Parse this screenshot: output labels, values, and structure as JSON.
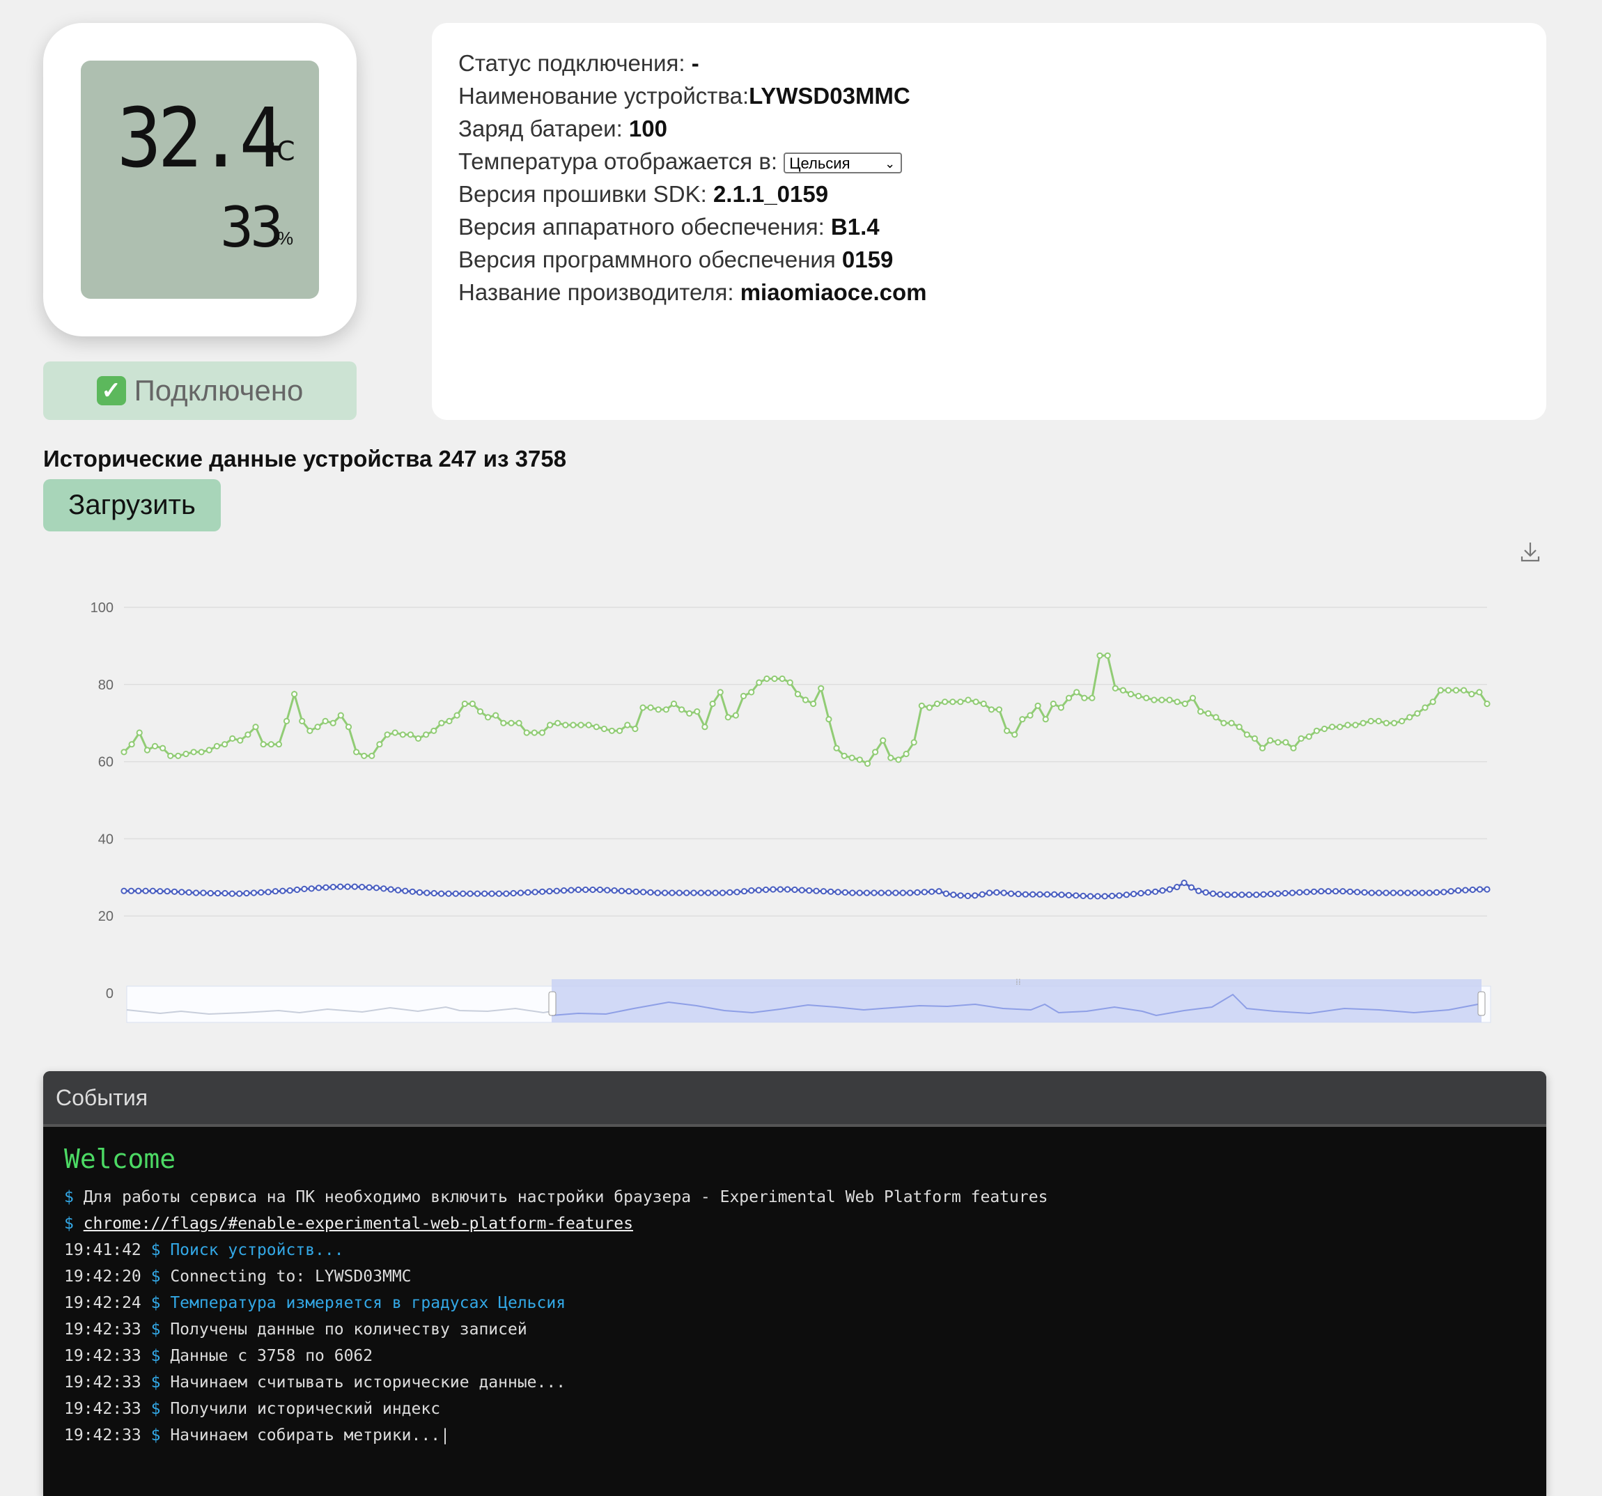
{
  "device": {
    "temperature": "32.4",
    "temperature_unit": "°C",
    "humidity": "33",
    "humidity_unit": "%"
  },
  "connection": {
    "badge_icon": "check-icon",
    "badge_label": "Подключено"
  },
  "info": {
    "status_label": "Статус подключения: ",
    "status_value": "-",
    "name_label": "Наименование устройства:",
    "name_value": "LYWSD03MMC",
    "battery_label": "Заряд батареи: ",
    "battery_value": "100",
    "temp_unit_label": "Температура отображается в: ",
    "temp_unit_selected": "Цельсия",
    "sdk_label": "Версия прошивки SDK: ",
    "sdk_value": "2.1.1_0159",
    "hw_label": "Версия аппаратного обеспечения: ",
    "hw_value": "B1.4",
    "sw_label": "Версия программного обеспечения ",
    "sw_value": "0159",
    "vendor_label": "Название производителя: ",
    "vendor_value": "miaomiaoce.com"
  },
  "history": {
    "title": "Исторические данные устройства 247 из 3758",
    "load_button": "Загрузить"
  },
  "chart_data": {
    "type": "line",
    "ylim": [
      0,
      100
    ],
    "yticks": [
      "0",
      "20",
      "40",
      "60",
      "80",
      "100"
    ],
    "grid": true,
    "series": [
      {
        "color": "#91cc75",
        "values": [
          62.5,
          64.5,
          67.5,
          63,
          64,
          63.5,
          61.5,
          61.5,
          62,
          62.5,
          62.5,
          63,
          64,
          64.5,
          66,
          65.5,
          67,
          69,
          64.5,
          64.5,
          64.5,
          70.5,
          77.5,
          70.5,
          68,
          69,
          70.5,
          70,
          72,
          69,
          62.5,
          61.5,
          61.5,
          64.5,
          67,
          67.5,
          67,
          67,
          66,
          67,
          68,
          70,
          70.5,
          72,
          75,
          75,
          73,
          71.5,
          72,
          70,
          70,
          70,
          67.5,
          67.5,
          67.5,
          69.5,
          70,
          69.5,
          69.5,
          69.5,
          69.5,
          69,
          68.5,
          68,
          68,
          69.5,
          68.5,
          74,
          74,
          73.5,
          73.5,
          75,
          73.5,
          72.5,
          73,
          69,
          75,
          78,
          71.5,
          72,
          77,
          78,
          80.5,
          81.5,
          81.5,
          81.5,
          80.5,
          77.5,
          76,
          75,
          79,
          71,
          63.5,
          61.5,
          61,
          60.5,
          59.5,
          62.5,
          65.5,
          61,
          60.5,
          62,
          65,
          74.5,
          74,
          75,
          75.5,
          75.5,
          75.5,
          76,
          75.5,
          75,
          73.5,
          73.5,
          68,
          67,
          71,
          72,
          74.5,
          71,
          75,
          74,
          76.5,
          78,
          76.5,
          76.5,
          87.5,
          87.5,
          79,
          78.5,
          77.5,
          77,
          76.5,
          76,
          76,
          76,
          75.5,
          75,
          76.5,
          73,
          72.5,
          71.5,
          70,
          70,
          69,
          67,
          66,
          63.5,
          65.5,
          65,
          65,
          63.5,
          66,
          66.5,
          68,
          68.5,
          69,
          69,
          69.5,
          69.5,
          70,
          70.5,
          70.5,
          70,
          70,
          70.5,
          71.5,
          72.5,
          74,
          75.5,
          78.5,
          78.5,
          78.5,
          78.5,
          77.5,
          78,
          75
        ]
      },
      {
        "color": "#4a5fc1",
        "values": [
          26.5,
          26.5,
          26.5,
          26.5,
          26.5,
          26.4,
          26.4,
          26.3,
          26.2,
          26.1,
          26,
          26,
          25.9,
          25.9,
          25.9,
          25.8,
          25.8,
          25.9,
          26,
          26.1,
          26.2,
          26.4,
          26.5,
          26.6,
          26.8,
          27,
          27.1,
          27.3,
          27.4,
          27.5,
          27.6,
          27.6,
          27.6,
          27.5,
          27.4,
          27.3,
          27.1,
          26.9,
          26.7,
          26.5,
          26.3,
          26.1,
          26,
          25.9,
          25.8,
          25.8,
          25.8,
          25.8,
          25.8,
          25.8,
          25.8,
          25.8,
          25.8,
          25.8,
          25.9,
          26,
          26.1,
          26.2,
          26.3,
          26.4,
          26.5,
          26.6,
          26.7,
          26.8,
          26.8,
          26.8,
          26.8,
          26.7,
          26.6,
          26.5,
          26.4,
          26.3,
          26.2,
          26.1,
          26,
          26,
          26,
          26,
          26,
          26,
          26,
          26,
          26,
          26,
          26.1,
          26.2,
          26.4,
          26.6,
          26.7,
          26.8,
          26.9,
          26.9,
          26.9,
          26.8,
          26.7,
          26.6,
          26.5,
          26.4,
          26.3,
          26.2,
          26.1,
          26,
          26,
          26,
          26,
          26,
          26,
          26,
          26,
          26,
          26.1,
          26.2,
          26.3,
          26.4,
          25.8,
          25.5,
          25.3,
          25.2,
          25.3,
          25.6,
          26,
          26.1,
          26,
          25.8,
          25.7,
          25.6,
          25.6,
          25.6,
          25.6,
          25.6,
          25.5,
          25.4,
          25.3,
          25.2,
          25.1,
          25.1,
          25.1,
          25.2,
          25.3,
          25.5,
          25.7,
          25.9,
          26.1,
          26.3,
          26.6,
          26.9,
          27.5,
          28.6,
          27.4,
          26.5,
          26.1,
          25.8,
          25.6,
          25.5,
          25.5,
          25.5,
          25.5,
          25.5,
          25.6,
          25.7,
          25.8,
          25.9,
          26,
          26.1,
          26.2,
          26.3,
          26.4,
          26.4,
          26.4,
          26.4,
          26.3,
          26.2,
          26.1,
          26,
          26,
          26,
          26,
          26,
          26,
          26,
          26,
          26,
          26.1,
          26.2,
          26.4,
          26.6,
          26.7,
          26.8,
          26.9,
          26.9
        ]
      }
    ]
  },
  "events": {
    "title": "События",
    "welcome": "Welcome",
    "intro_1": "Для работы сервиса на ПК необходимо включить настройки браузера - Experimental Web Platform features",
    "intro_2": "chrome://flags/#enable-experimental-web-platform-features",
    "logs": [
      {
        "time": "19:41:42",
        "text": "Поиск устройств...",
        "highlight": true
      },
      {
        "time": "19:42:20",
        "text": "Connecting to: LYWSD03MMC",
        "highlight": false
      },
      {
        "time": "19:42:24",
        "text": "Температура измеряется в градусах Цельсия",
        "highlight": true
      },
      {
        "time": "19:42:33",
        "text": "Получены данные по количеству записей",
        "highlight": false
      },
      {
        "time": "19:42:33",
        "text": "Данные с 3758 по 6062",
        "highlight": false
      },
      {
        "time": "19:42:33",
        "text": "Начинаем считывать исторические данные...",
        "highlight": false
      },
      {
        "time": "19:42:33",
        "text": "Получили исторический индекс",
        "highlight": false
      },
      {
        "time": "19:42:33",
        "text": "Начинаем собирать метрики...",
        "highlight": false
      }
    ]
  }
}
